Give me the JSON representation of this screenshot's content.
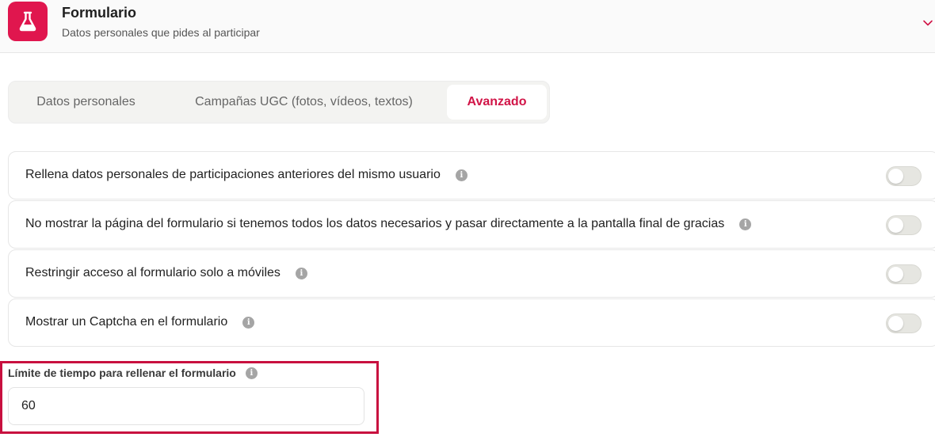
{
  "header": {
    "title": "Formulario",
    "subtitle": "Datos personales que pides al participar",
    "icon": "flask-icon",
    "accent_color": "#e0164e"
  },
  "tabs": [
    {
      "label": "Datos personales",
      "active": false
    },
    {
      "label": "Campañas UGC (fotos, vídeos, textos)",
      "active": false
    },
    {
      "label": "Avanzado",
      "active": true
    }
  ],
  "options": [
    {
      "label": "Rellena datos personales de participaciones anteriores del mismo usuario",
      "enabled": false
    },
    {
      "label": "No mostrar la página del formulario si tenemos todos los datos necesarios y pasar directamente a la pantalla final de gracias",
      "enabled": false
    },
    {
      "label": "Restringir acceso al formulario solo a móviles",
      "enabled": false
    },
    {
      "label": "Mostrar un Captcha en el formulario",
      "enabled": false
    }
  ],
  "time_limit": {
    "label": "Límite de tiempo para rellenar el formulario",
    "value": "60"
  },
  "info_glyph": "i",
  "highlight_color": "#c8103f"
}
